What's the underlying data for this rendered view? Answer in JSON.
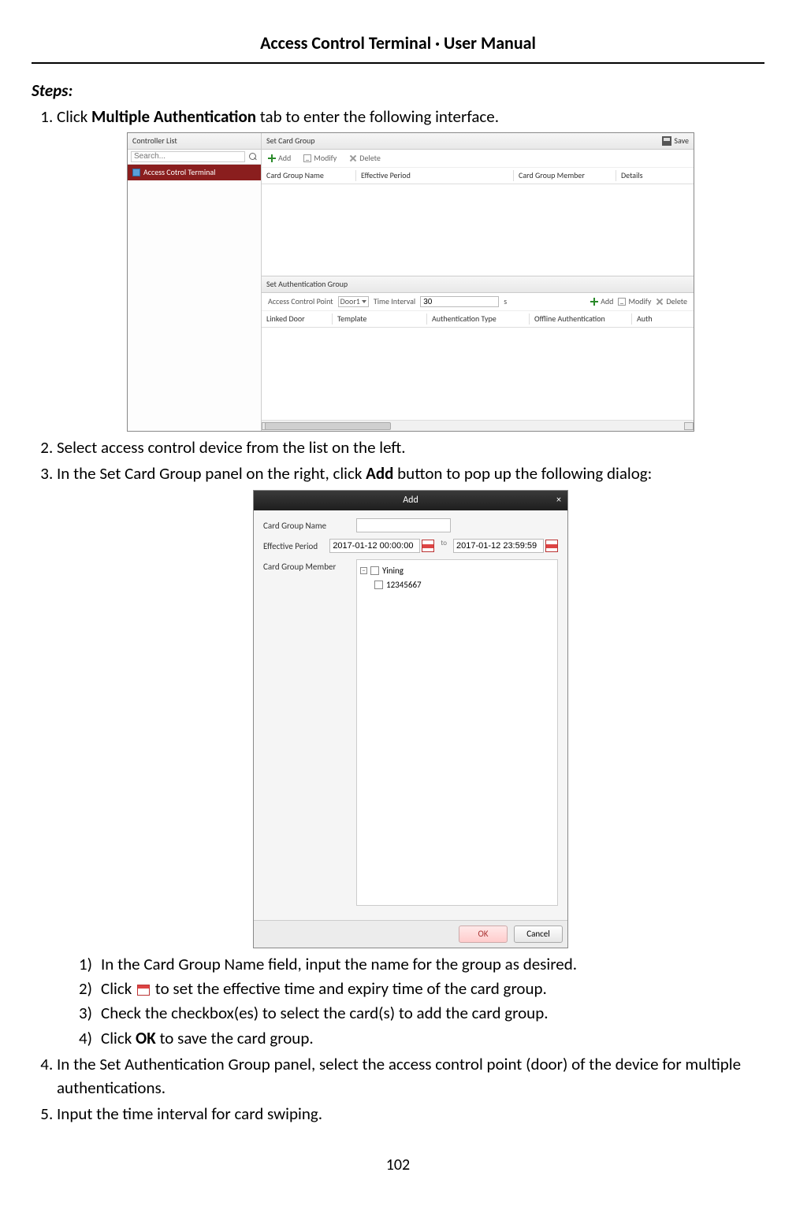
{
  "header": "Access Control Terminal · User Manual",
  "steps_title": "Steps:",
  "steps": {
    "s1_pre": "Click ",
    "s1_bold": "Multiple Authentication",
    "s1_post": " tab to enter the following interface.",
    "s2": "Select access control device from the list on the left.",
    "s3_pre": "In the Set Card Group panel on the right, click ",
    "s3_bold": "Add",
    "s3_post": " button to pop up the following dialog:",
    "sub": {
      "a": "In the Card Group Name field, input the name for the group as desired.",
      "b_pre": "Click ",
      "b_post": " to set the effective time and expiry time of the card group.",
      "c": "Check the checkbox(es) to select the card(s) to add the card group.",
      "d_pre": "Click ",
      "d_bold": "OK",
      "d_post": " to save the card group."
    },
    "s4": "In the Set Authentication Group panel, select the access control point (door) of the device for multiple authentications.",
    "s5": "Input the time interval for card swiping."
  },
  "shot1": {
    "controller_list": "Controller List",
    "search_placeholder": "Search...",
    "device": "Access Cotrol Terminal",
    "set_card_group": "Set Card Group",
    "save": "Save",
    "add": "Add",
    "modify": "Modify",
    "delete": "Delete",
    "cols1": {
      "c1": "Card Group Name",
      "c2": "Effective Period",
      "c3": "Card Group Member",
      "c4": "Details"
    },
    "set_auth_group": "Set Authentication Group",
    "acp_label": "Access Control Point",
    "door": "Door1",
    "time_interval_label": "Time Interval",
    "time_interval_value": "30",
    "time_interval_unit": "s",
    "cols2": {
      "c1": "Linked Door",
      "c2": "Template",
      "c3": "Authentication Type",
      "c4": "Offline Authentication",
      "c5": "Auth"
    }
  },
  "shot2": {
    "title": "Add",
    "labels": {
      "name": "Card Group Name",
      "period": "Effective Period",
      "member": "Card Group Member"
    },
    "period": {
      "start": "2017-01-12 00:00:00",
      "to": "to",
      "end": "2017-01-12 23:59:59"
    },
    "tree": {
      "org": "Yining",
      "card": "12345667"
    },
    "ok": "OK",
    "cancel": "Cancel"
  },
  "page_number": "102"
}
